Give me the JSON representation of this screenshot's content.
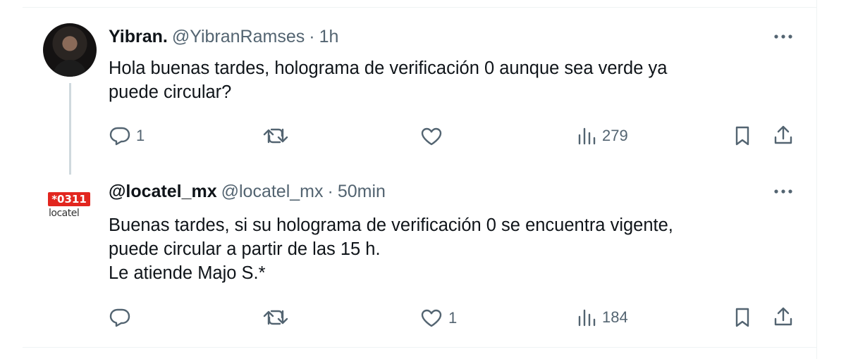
{
  "tweets": [
    {
      "name": "Yibran.",
      "handle": "@YibranRamses",
      "separator": "·",
      "time": "1h",
      "lines": [
        "Hola buenas tardes, holograma de verificación 0 aunque sea verde ya",
        "puede circular?"
      ],
      "replies": "1",
      "retweets": "",
      "likes": "",
      "views": "279"
    },
    {
      "name": "@locatel_mx",
      "handle": "@locatel_mx",
      "separator": "·",
      "time": "50min",
      "logo_badge": "*0311",
      "logo_word": "locatel",
      "lines": [
        "Buenas tardes, si su holograma de verificación 0 se encuentra vigente,",
        "puede circular a partir de las 15 h.",
        "Le atiende Majo S.*"
      ],
      "replies": "",
      "retweets": "",
      "likes": "1",
      "views": "184"
    }
  ],
  "icons": {
    "more": "more-dots-icon",
    "reply": "reply-bubble-icon",
    "retweet": "retweet-arrows-icon",
    "like": "heart-icon",
    "views": "bar-chart-icon",
    "bookmark": "bookmark-icon",
    "share": "share-upload-icon"
  },
  "colors": {
    "text": "#0f1419",
    "muted": "#536471",
    "divider": "#eff3f4",
    "logo_red": "#e2261f"
  }
}
